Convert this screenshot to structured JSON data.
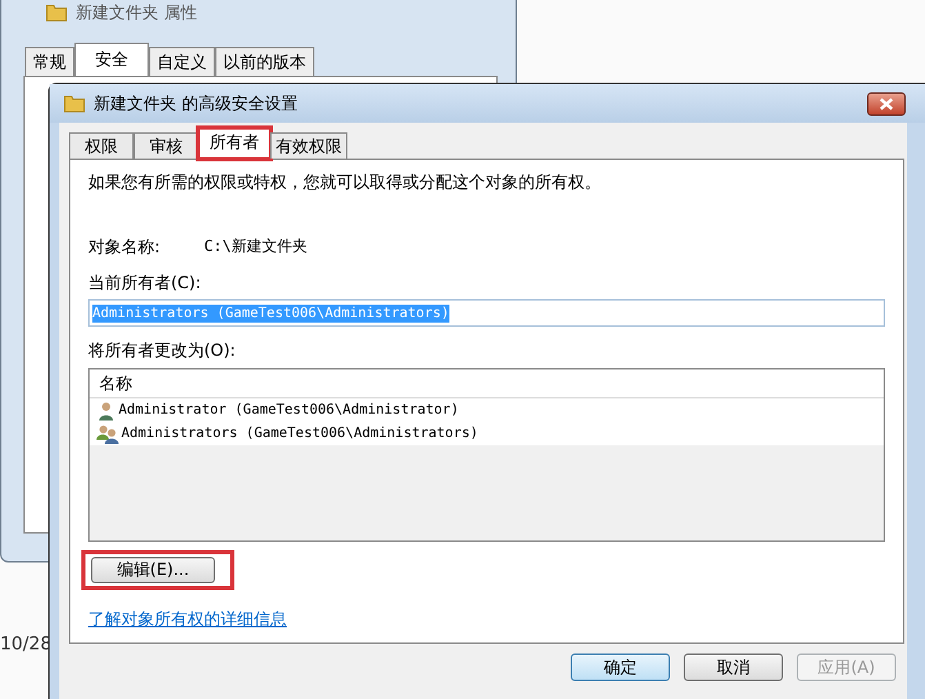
{
  "back_window": {
    "title": "新建文件夹 属性",
    "tabs": [
      {
        "label": "常规",
        "selected": false
      },
      {
        "label": "安全",
        "selected": true
      },
      {
        "label": "自定义",
        "selected": false
      },
      {
        "label": "以前的版本",
        "selected": false
      }
    ]
  },
  "desktop_text": "10/28",
  "dialog": {
    "title": "新建文件夹 的高级安全设置",
    "tabs": [
      {
        "label": "权限",
        "selected": false,
        "highlighted": false
      },
      {
        "label": "审核",
        "selected": false,
        "highlighted": false
      },
      {
        "label": "所有者",
        "selected": true,
        "highlighted": true
      },
      {
        "label": "有效权限",
        "selected": false,
        "highlighted": false
      }
    ],
    "intro": "如果您有所需的权限或特权，您就可以取得或分配这个对象的所有权。",
    "object_label": "对象名称:",
    "object_value": "C:\\新建文件夹",
    "current_owner_label": "当前所有者(C):",
    "current_owner_value": "Administrators (GameTest006\\Administrators)",
    "change_label": "将所有者更改为(O):",
    "list": {
      "column": "名称",
      "rows": [
        {
          "kind": "user",
          "name": "Administrator (GameTest006\\Administrator)"
        },
        {
          "kind": "group",
          "name": "Administrators (GameTest006\\Administrators)"
        }
      ]
    },
    "edit_button": {
      "label": "编辑(E)...",
      "highlighted": true
    },
    "link": "了解对象所有权的详细信息",
    "buttons": [
      {
        "label": "确定",
        "default": true,
        "disabled": false
      },
      {
        "label": "取消",
        "default": false,
        "disabled": false
      },
      {
        "label": "应用(A)",
        "default": false,
        "disabled": true
      }
    ]
  }
}
